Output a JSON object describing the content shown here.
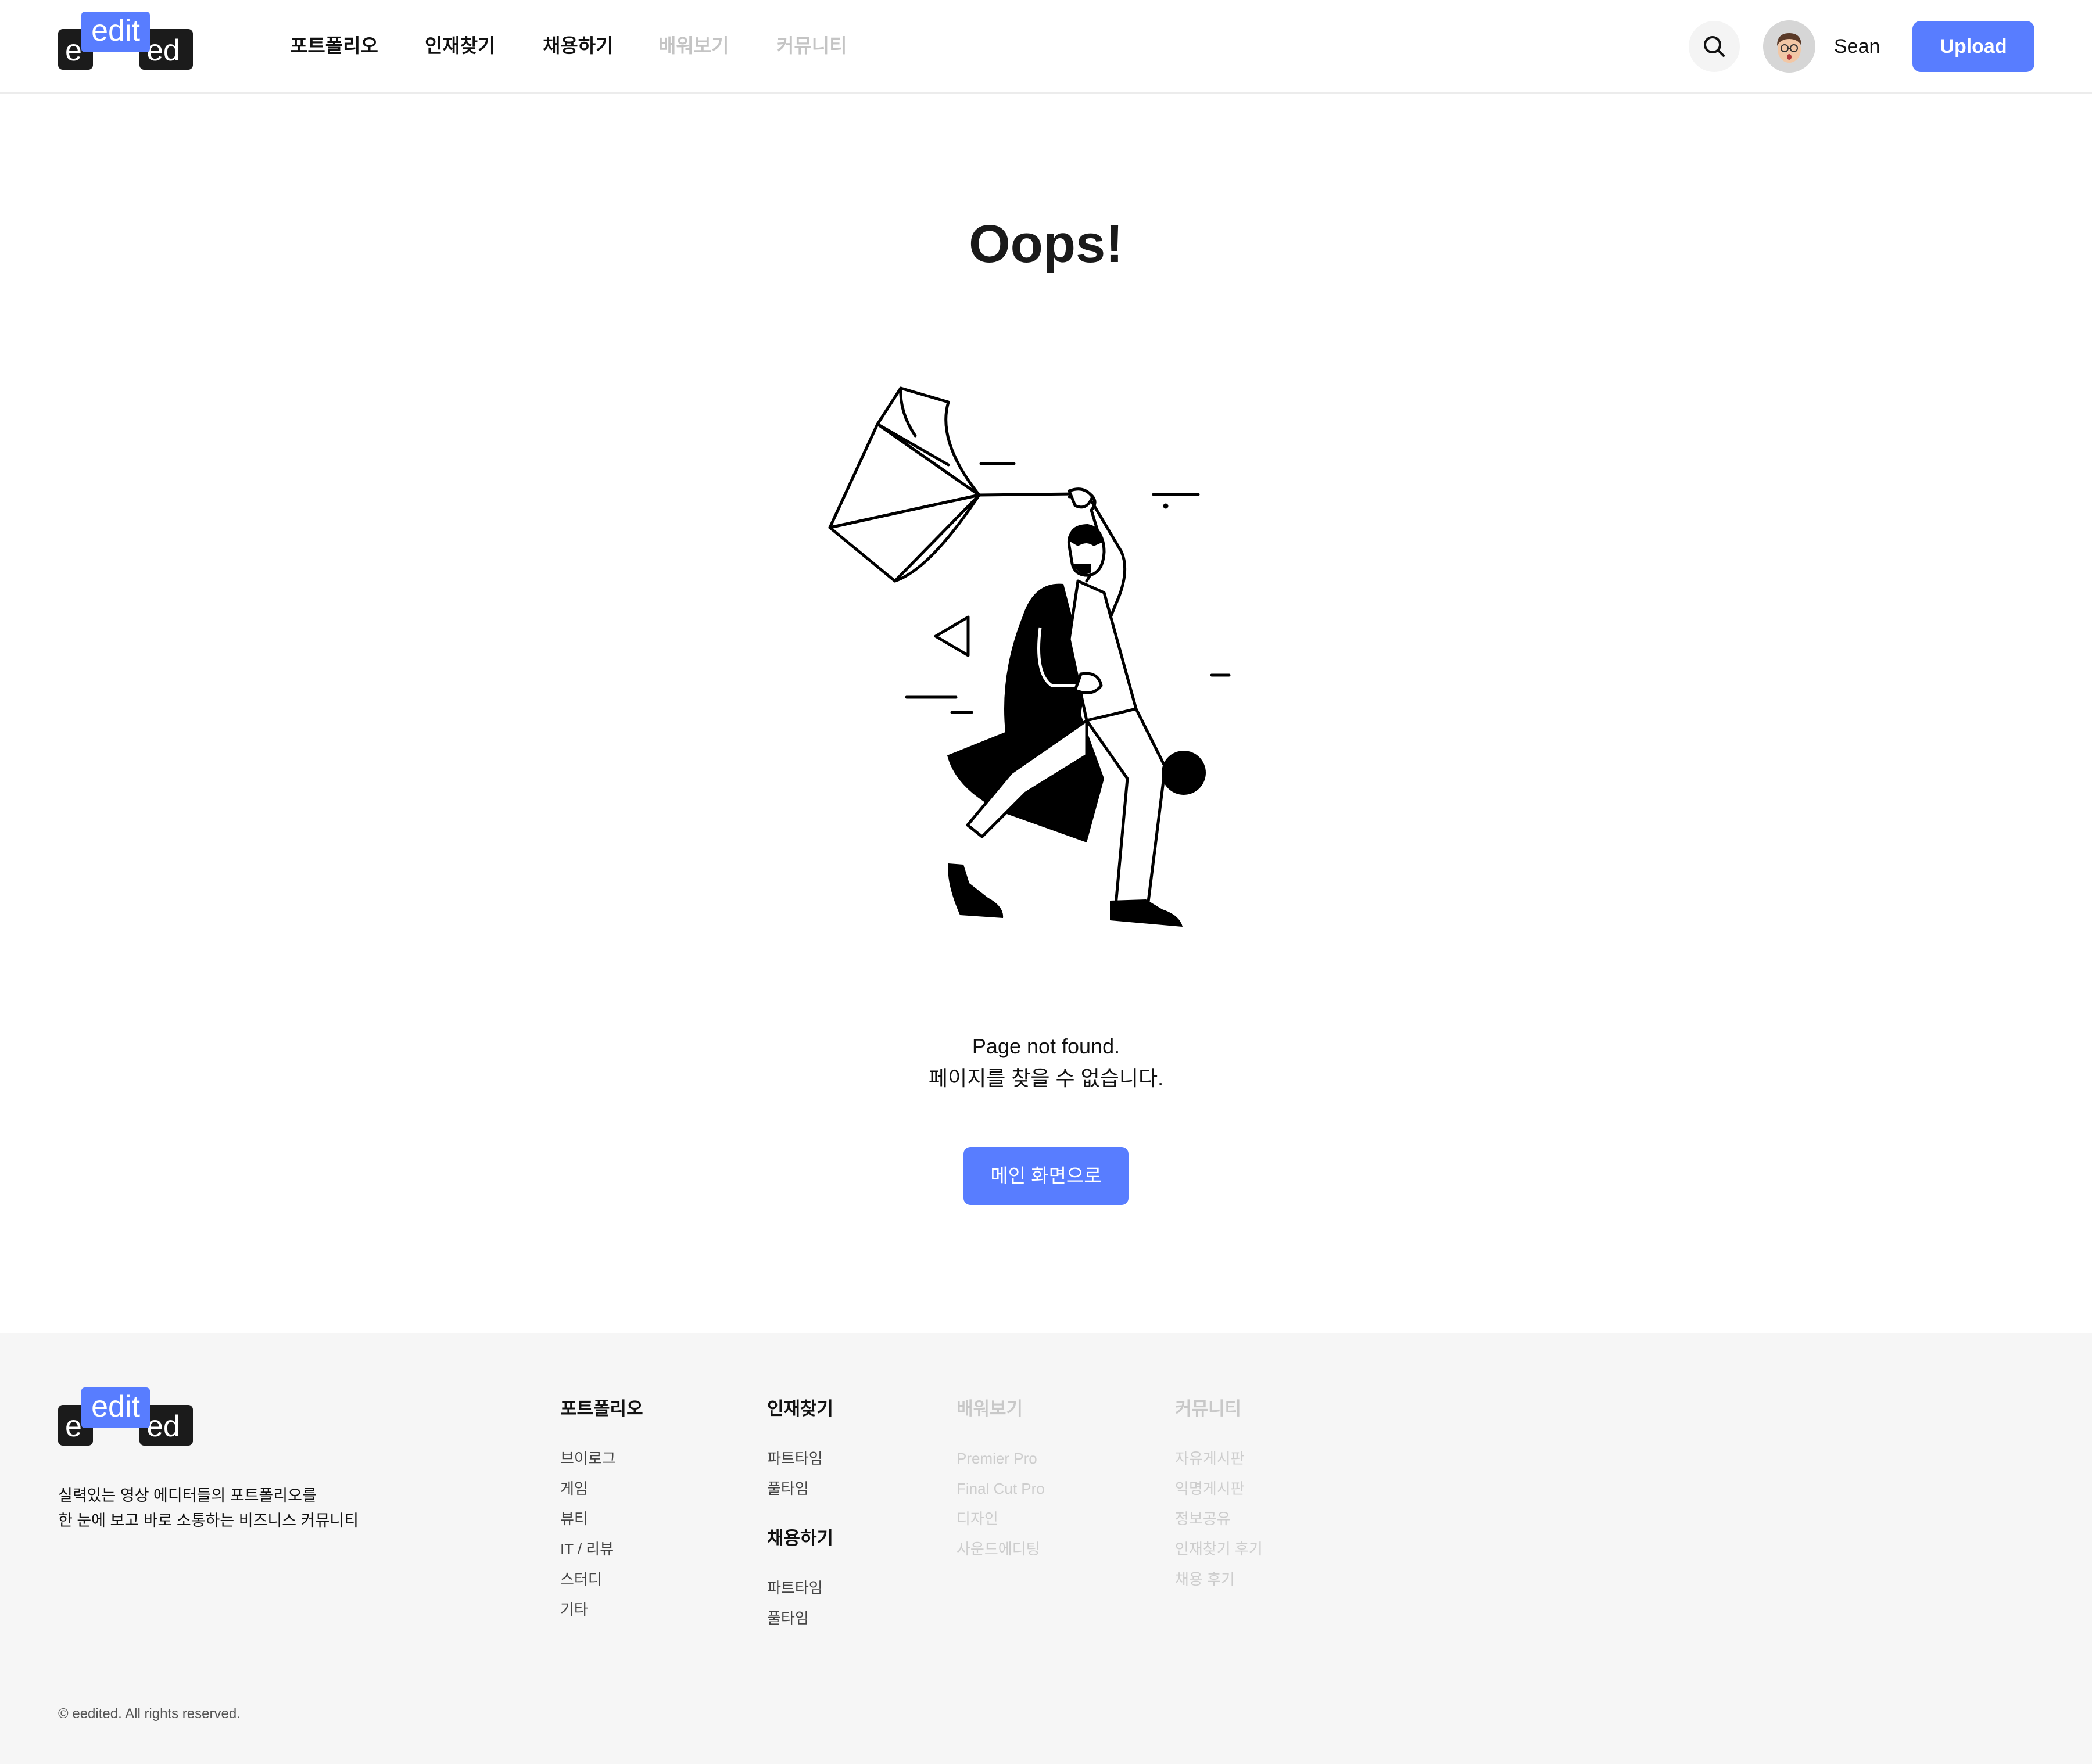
{
  "header": {
    "logo": {
      "left": "e",
      "highlight": "edit",
      "right": "ed"
    },
    "nav": [
      {
        "label": "포트폴리오",
        "enabled": true
      },
      {
        "label": "인재찾기",
        "enabled": true
      },
      {
        "label": "채용하기",
        "enabled": true
      },
      {
        "label": "배워보기",
        "enabled": false
      },
      {
        "label": "커뮤니티",
        "enabled": false
      }
    ],
    "search_icon": "search-icon",
    "user": {
      "name": "Sean",
      "avatar": "avatar-face"
    },
    "upload_label": "Upload"
  },
  "main": {
    "title": "Oops!",
    "illustration": "man-with-broken-umbrella-in-wind",
    "message_en": "Page not found.",
    "message_ko": "페이지를 찾을 수 없습니다.",
    "button_label": "메인 화면으로"
  },
  "footer": {
    "logo": {
      "left": "e",
      "highlight": "edit",
      "right": "ed"
    },
    "tagline": [
      "실력있는 영상 에디터들의 포트폴리오를",
      "한 눈에 보고 바로 소통하는 비즈니스 커뮤니티"
    ],
    "columns": [
      {
        "heading": "포트폴리오",
        "enabled": true,
        "links": [
          "브이로그",
          "게임",
          "뷰티",
          "IT / 리뷰",
          "스터디",
          "기타"
        ]
      },
      {
        "heading": "인재찾기",
        "enabled": true,
        "links": [
          "파트타임",
          "풀타임"
        ]
      },
      {
        "heading": "채용하기",
        "enabled": true,
        "links": [
          "파트타임",
          "풀타임"
        ]
      },
      {
        "heading": "배워보기",
        "enabled": false,
        "links": [
          "Premier Pro",
          "Final Cut Pro",
          "디자인",
          "사운드에디팅"
        ]
      },
      {
        "heading": "커뮤니티",
        "enabled": false,
        "links": [
          "자유게시판",
          "익명게시판",
          "정보공유",
          "인재찾기 후기",
          "채용 후기"
        ]
      }
    ],
    "copyright": "© eedited. All rights reserved."
  },
  "colors": {
    "accent": "#587dff",
    "text": "#111111",
    "disabled": "#c4c4c4",
    "footer_bg": "#f6f6f6",
    "logo_dark": "#1b1b1b"
  }
}
